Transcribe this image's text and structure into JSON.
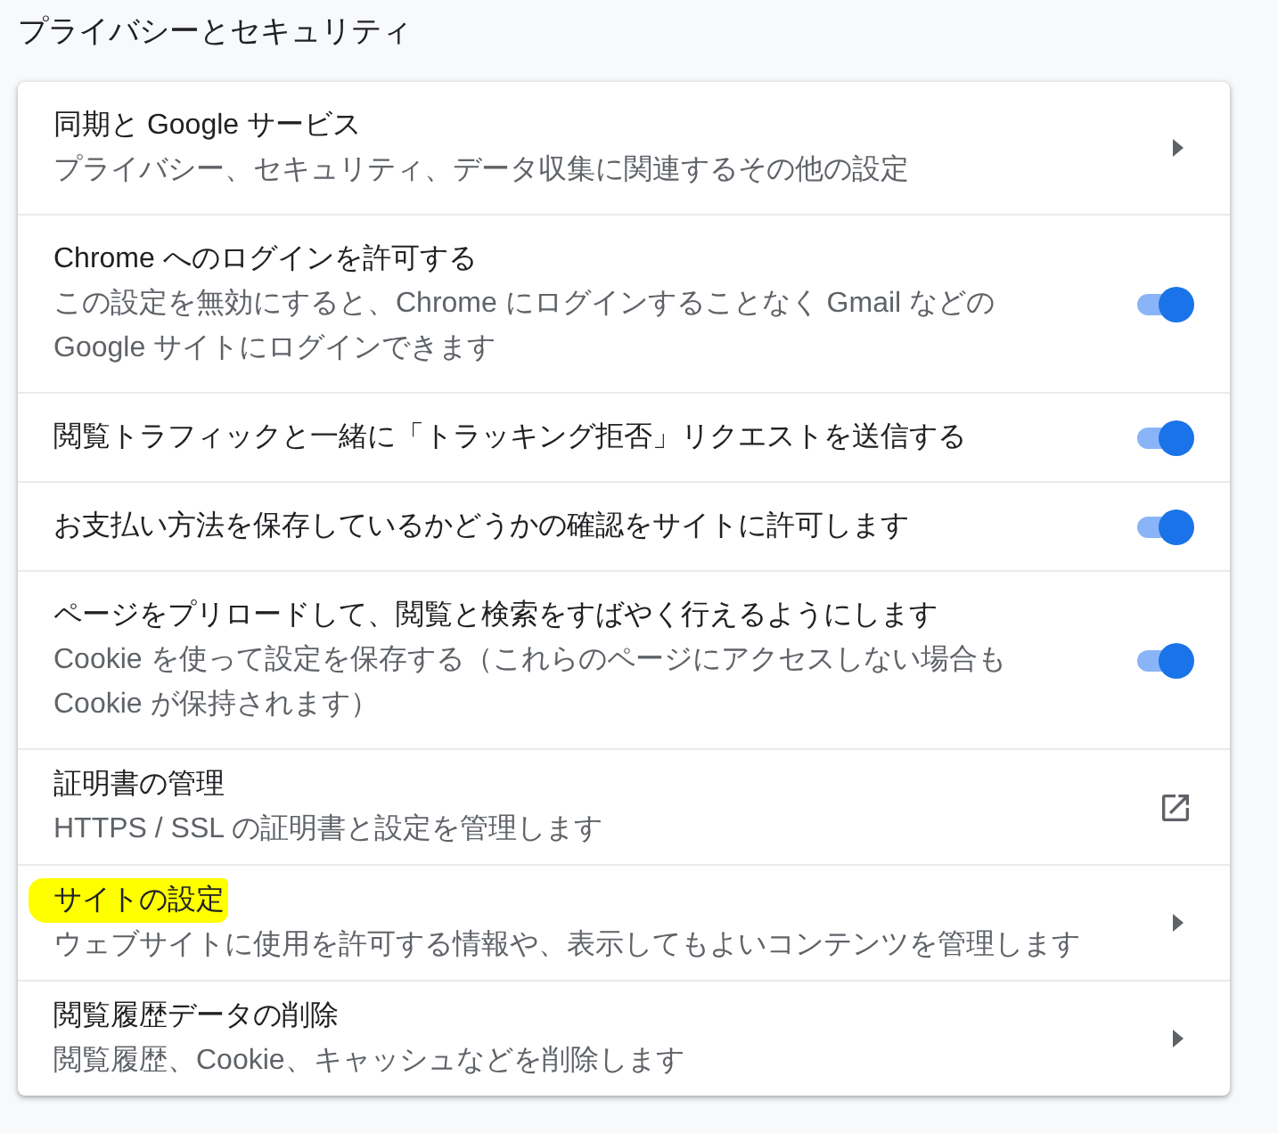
{
  "page": {
    "title": "プライバシーとセキュリティ"
  },
  "settings": [
    {
      "kind": "subpage",
      "title": "同期と Google サービス",
      "description": "プライバシー、セキュリティ、データ収集に関連するその他の設定",
      "highlighted": false
    },
    {
      "kind": "toggle",
      "title": "Chrome へのログインを許可する",
      "description": "この設定を無効にすると、Chrome にログインすることなく Gmail などの Google サイトにログインできます",
      "highlighted": false,
      "on": true
    },
    {
      "kind": "toggle",
      "title": "閲覧トラフィックと一緒に「トラッキング拒否」リクエストを送信する",
      "highlighted": false,
      "on": true
    },
    {
      "kind": "toggle",
      "title": "お支払い方法を保存しているかどうかの確認をサイトに許可します",
      "highlighted": false,
      "on": true
    },
    {
      "kind": "toggle",
      "title": "ページをプリロードして、閲覧と検索をすばやく行えるようにします",
      "description": "Cookie を使って設定を保存する（これらのページにアクセスしない場合も Cookie が保持されます）",
      "highlighted": false,
      "on": true
    },
    {
      "kind": "external",
      "title": "証明書の管理",
      "description": "HTTPS / SSL の証明書と設定を管理します",
      "highlighted": false
    },
    {
      "kind": "subpage",
      "title": "サイトの設定",
      "description": "ウェブサイトに使用を許可する情報や、表示してもよいコンテンツを管理します",
      "highlighted": true
    },
    {
      "kind": "subpage",
      "title": "閲覧履歴データの削除",
      "description": "閲覧履歴、Cookie、キャッシュなどを削除します",
      "highlighted": false
    }
  ]
}
